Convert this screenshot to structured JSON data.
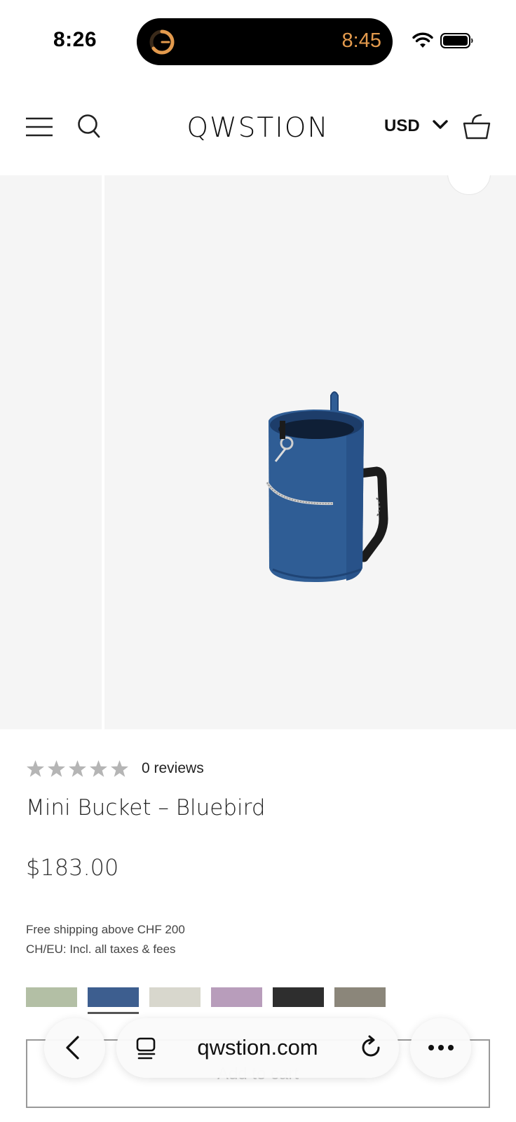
{
  "status_bar": {
    "time": "8:26",
    "island_time": "8:45",
    "icons": [
      "timer-icon",
      "wifi-icon",
      "battery-icon"
    ]
  },
  "header": {
    "logo": "QWSTION",
    "currency": "USD",
    "icons": [
      "menu-icon",
      "search-icon",
      "chevron-down-icon",
      "cart-icon"
    ]
  },
  "product": {
    "rating_stars": 0,
    "rating_max": 5,
    "reviews": "0 reviews",
    "title": "Mini Bucket – Bluebird",
    "price": "$183.00",
    "shipping_line1": "Free shipping above CHF 200",
    "shipping_line2": "CH/EU: Incl. all taxes & fees",
    "image_icon": "bucket-bag-image",
    "swatches": [
      {
        "color": "#b3bfa5",
        "selected": false
      },
      {
        "color": "#3d5e8f",
        "selected": true
      },
      {
        "color": "#d8d7cd",
        "selected": false
      },
      {
        "color": "#b89dbb",
        "selected": false
      },
      {
        "color": "#2e2e2e",
        "selected": false
      },
      {
        "color": "#8b867a",
        "selected": false
      }
    ],
    "add_to_cart": "Add to cart"
  },
  "browser": {
    "url": "qwstion.com",
    "icons": [
      "back-icon",
      "tabs-icon",
      "reload-icon",
      "more-icon"
    ]
  },
  "colors": {
    "island_text": "#e39a4d",
    "gallery_bg": "#f5f5f5",
    "bag_blue": "#2f5d95"
  }
}
